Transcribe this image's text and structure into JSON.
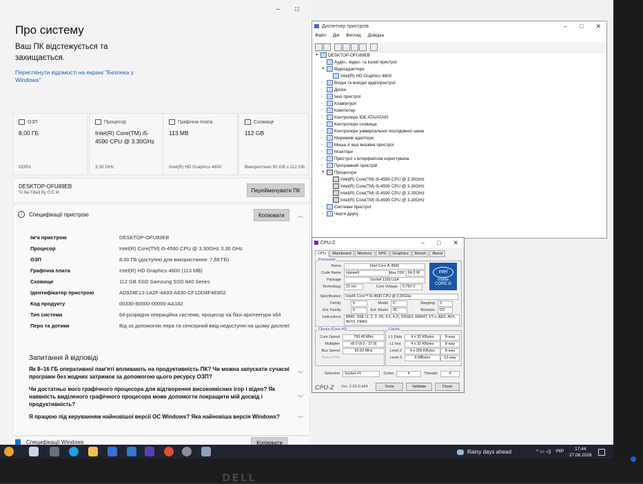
{
  "settings": {
    "title": "Про систему",
    "win_min": "–",
    "win_max": "□",
    "win_close": "✕",
    "protect_text": "Ваш ПК відстежується та захищається.",
    "security_link": "Переглянути відомості на екрані \"Безпека у Windows\"",
    "cards": [
      {
        "title": "ОЗП",
        "value": "8,00 ГБ",
        "sub": "DDR3"
      },
      {
        "title": "Процесор",
        "value": "Intel(R) Core(TM) i5-4590 CPU @ 3.30GHz",
        "sub": "3,30 GHz"
      },
      {
        "title": "Графічна плата",
        "value": "113 MB",
        "sub": "Intel(R) HD Graphics 4600"
      },
      {
        "title": "Сховище",
        "value": "112 GB",
        "sub": "Використано 50 GB з 112 GB"
      }
    ],
    "device_name": "DESKTOP-OFU89EB",
    "device_sub": "To Be Filled By O.E.M.",
    "rename_button": "Перейменувати ПК",
    "spec_header": "Специфікації пристрою",
    "copy_button": "Копіювати",
    "specs": [
      {
        "k": "Ім'я пристрою",
        "v": "DESKTOP-OFU89EB"
      },
      {
        "k": "Процесор",
        "v": "Intel(R) Core(TM) i5-4590 CPU @ 3.30GHz   3.30 GHz"
      },
      {
        "k": "ОЗП",
        "v": "8,00 ГБ (доступно для використання: 7,68 ГБ)"
      },
      {
        "k": "Графічна плата",
        "v": "Intel(R) HD Graphics 4600 (113 MB)"
      },
      {
        "k": "Сховище",
        "v": "112 GB SSD Samsung SSD 840 Series"
      },
      {
        "k": "Ідентифікатор пристрою",
        "v": "AD924E13-1A2F-4A93-A630-CF1DD8F4E802"
      },
      {
        "k": "Код продукту",
        "v": "00330-80000-00000-AA182"
      },
      {
        "k": "Тип системи",
        "v": "64-розрядна операційна система, процесор на базі архітектури x64"
      },
      {
        "k": "Перо та дотики",
        "v": "Від за допомогою пера та сенсорний ввід недоступні на цьому дисплеї"
      }
    ],
    "qa_title": "Запитання й відповіді",
    "qa": [
      "Як 8–16 ГБ оперативної пам'яті впливають на продуктивність ПК? Чи можна запускати сучасні програми без жодних затримок за допомогою цього ресурсу ОЗП?",
      "Чи достатньо мого графічного процесора для відтворення високоякісних ігор і відео? Як наявність виділеного графічного процесора може допомогти покращити мій досвід і продуктивність?",
      "Я працюю під керуванням найновішої версії ОС Windows? Яка найновіша версія Windows?"
    ],
    "bottom_spec": "Специфікації Windows",
    "bottom_copy": "Копіювати"
  },
  "devmgr": {
    "title": "Диспетчер пристроїв",
    "menu": [
      "Файл",
      "Дія",
      "Вигляд",
      "Довідка"
    ],
    "win_min": "–",
    "win_max": "□",
    "win_close": "✕",
    "tree": [
      {
        "label": "DESKTOP-OFU89EB",
        "level": 0,
        "exp": "open",
        "icon": "computer"
      },
      {
        "label": "Аудіо-, відео- та ігрові пристрої",
        "level": 1,
        "exp": "closed",
        "icon": "audio"
      },
      {
        "label": "Відеоадаптери",
        "level": 1,
        "exp": "open",
        "icon": "display"
      },
      {
        "label": "Intel(R) HD Graphics 4600",
        "level": 2,
        "exp": "",
        "icon": "display"
      },
      {
        "label": "Вхідні та вихідні аудіопристрої",
        "level": 1,
        "exp": "closed",
        "icon": "audio"
      },
      {
        "label": "Диски",
        "level": 1,
        "exp": "closed",
        "icon": "disk"
      },
      {
        "label": "Інші пристрої",
        "level": 1,
        "exp": "closed",
        "icon": "other"
      },
      {
        "label": "Клавіатури",
        "level": 1,
        "exp": "closed",
        "icon": "keyboard"
      },
      {
        "label": "Комп'ютер",
        "level": 1,
        "exp": "closed",
        "icon": "computer"
      },
      {
        "label": "Контролери IDE ATA/ATAPI",
        "level": 1,
        "exp": "closed",
        "icon": "controller"
      },
      {
        "label": "Контролери сховища",
        "level": 1,
        "exp": "closed",
        "icon": "controller"
      },
      {
        "label": "Контролери універсальної послідовної шини",
        "level": 1,
        "exp": "closed",
        "icon": "usb"
      },
      {
        "label": "Мережеві адаптери",
        "level": 1,
        "exp": "closed",
        "icon": "network"
      },
      {
        "label": "Миша й інші вказівні пристрої",
        "level": 1,
        "exp": "closed",
        "icon": "mouse"
      },
      {
        "label": "Монітори",
        "level": 1,
        "exp": "closed",
        "icon": "monitor"
      },
      {
        "label": "Пристрої з інтерфейсом користувача",
        "level": 1,
        "exp": "closed",
        "icon": "hid"
      },
      {
        "label": "Програмний пристрій",
        "level": 1,
        "exp": "closed",
        "icon": "software"
      },
      {
        "label": "Процесори",
        "level": 1,
        "exp": "open",
        "icon": "cpu"
      },
      {
        "label": "Intel(R) Core(TM) i5-4590 CPU @ 3.30GHz",
        "level": 2,
        "exp": "",
        "icon": "cpu"
      },
      {
        "label": "Intel(R) Core(TM) i5-4590 CPU @ 3.30GHz",
        "level": 2,
        "exp": "",
        "icon": "cpu"
      },
      {
        "label": "Intel(R) Core(TM) i5-4590 CPU @ 3.30GHz",
        "level": 2,
        "exp": "",
        "icon": "cpu"
      },
      {
        "label": "Intel(R) Core(TM) i5-4590 CPU @ 3.30GHz",
        "level": 2,
        "exp": "",
        "icon": "cpu"
      },
      {
        "label": "Системні пристрої",
        "level": 1,
        "exp": "closed",
        "icon": "system"
      },
      {
        "label": "Черги друку",
        "level": 1,
        "exp": "closed",
        "icon": "printer"
      }
    ]
  },
  "cpuz": {
    "title": "CPU-Z",
    "win_min": "–",
    "win_max": "□",
    "win_close": "✕",
    "tabs": [
      "CPU",
      "Mainboard",
      "Memory",
      "SPD",
      "Graphics",
      "Bench",
      "About"
    ],
    "processor_group": "Processor",
    "name_l": "Name",
    "name_v": "Intel Core i5 4590",
    "codename_l": "Code Name",
    "codename_v": "Haswell",
    "maxtdp_l": "Max TDP",
    "maxtdp_v": "84.0 W",
    "package_l": "Package",
    "package_v": "Socket 1150 LGA",
    "tech_l": "Technology",
    "tech_v": "22 nm",
    "voltage_l": "Core Voltage",
    "voltage_v": "0.760 V",
    "spec_l": "Specification",
    "spec_v": "Intel® Core™ i5-4590 CPU @ 3.30GHz",
    "family_l": "Family",
    "family_v": "6",
    "model_l": "Model",
    "model_v": "C",
    "stepping_l": "Stepping",
    "stepping_v": "3",
    "extfamily_l": "Ext. Family",
    "extfamily_v": "6",
    "extmodel_l": "Ext. Model",
    "extmodel_v": "3C",
    "revision_l": "Revision",
    "revision_v": "C0",
    "instr_l": "Instructions",
    "instr_v": "MMX, SSE (1, 2, 3, 3S, 4.1, 4.2), SSSE3, EM64T, VT-x, AES, AVX, AVX2, FMA3",
    "clocks_group": "Clocks (Core #0)",
    "corespeed_l": "Core Speed",
    "corespeed_v": "799.48 MHz",
    "mult_l": "Multiplier",
    "mult_v": "x8.0 (8.0 - 37.0)",
    "bus_l": "Bus Speed",
    "bus_v": "99.93 MHz",
    "ratedfsb_l": "Rated FSB",
    "cache_group": "Cache",
    "l1d_l": "L1 Data",
    "l1d_v": "4 x 32 KBytes",
    "l1d_w": "8-way",
    "l1i_l": "L1 Inst.",
    "l1i_v": "4 x 32 KBytes",
    "l1i_w": "8-way",
    "l2_l": "Level 2",
    "l2_v": "4 x 256 KBytes",
    "l2_w": "8-way",
    "l3_l": "Level 3",
    "l3_v": "6 MBytes",
    "l3_w": "12-way",
    "selection_l": "Selection",
    "selection_v": "Socket #1",
    "cores_l": "Cores",
    "cores_v": "4",
    "threads_l": "Threads",
    "threads_v": "4",
    "logo": "CPU-Z",
    "version": "Ver. 2.20.0.x64",
    "tools_btn": "Tools",
    "validate_btn": "Validate",
    "close_btn": "Close",
    "intel_brand": "intel",
    "intel_inside": "inside",
    "intel_core": "CORE i5"
  },
  "taskbar": {
    "weather": "Rainy days ahead",
    "lang": "УКР",
    "time": "17:44",
    "date": "27.06.2026"
  },
  "monitor": {
    "brand": "DELL"
  }
}
